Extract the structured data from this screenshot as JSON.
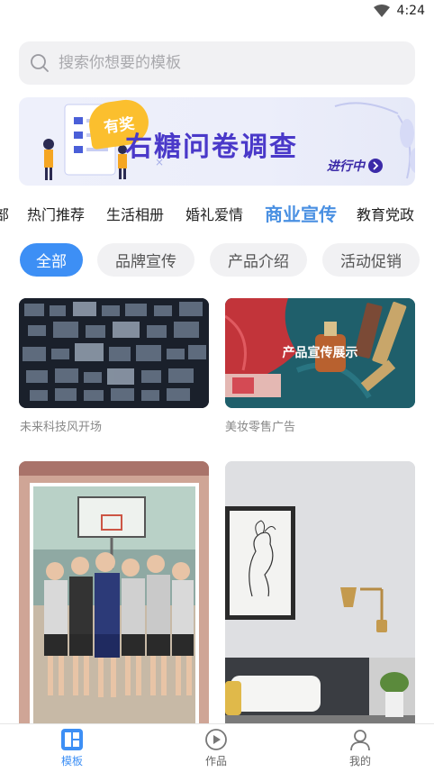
{
  "status_bar": {
    "time": "4:24",
    "icons": [
      "wifi-icon",
      "battery-icon"
    ]
  },
  "search": {
    "placeholder": "搜索你想要的模板",
    "icon": "search-icon"
  },
  "banner": {
    "badge": "有奖",
    "title": "右糖问卷调查",
    "action": "进行中"
  },
  "category_tabs": {
    "items": [
      "部",
      "热门推荐",
      "生活相册",
      "婚礼爱情",
      "商业宣传",
      "教育党政"
    ],
    "active": "商业宣传"
  },
  "filter_chips": {
    "items": [
      "全部",
      "品牌宣传",
      "产品介绍",
      "活动促销"
    ],
    "active": "全部"
  },
  "templates": [
    {
      "label": "未来科技风开场",
      "thumb": "tech-collage-thumbnail"
    },
    {
      "label": "美妆零售广告",
      "thumb": "cosmetics-thumbnail",
      "overlay": "产品宣传展示"
    },
    {
      "label": "",
      "thumb": "basketball-team-thumbnail"
    },
    {
      "label": "",
      "thumb": "interior-decor-thumbnail"
    }
  ],
  "bottom_nav": {
    "items": [
      {
        "label": "模板",
        "icon": "template-icon"
      },
      {
        "label": "作品",
        "icon": "play-icon"
      },
      {
        "label": "我的",
        "icon": "profile-icon"
      }
    ],
    "active": "模板"
  },
  "colors": {
    "accent": "#3d8ff5",
    "tab_active": "#4a90e2",
    "banner_title": "#4a39c9",
    "badge": "#fbbf2e"
  }
}
